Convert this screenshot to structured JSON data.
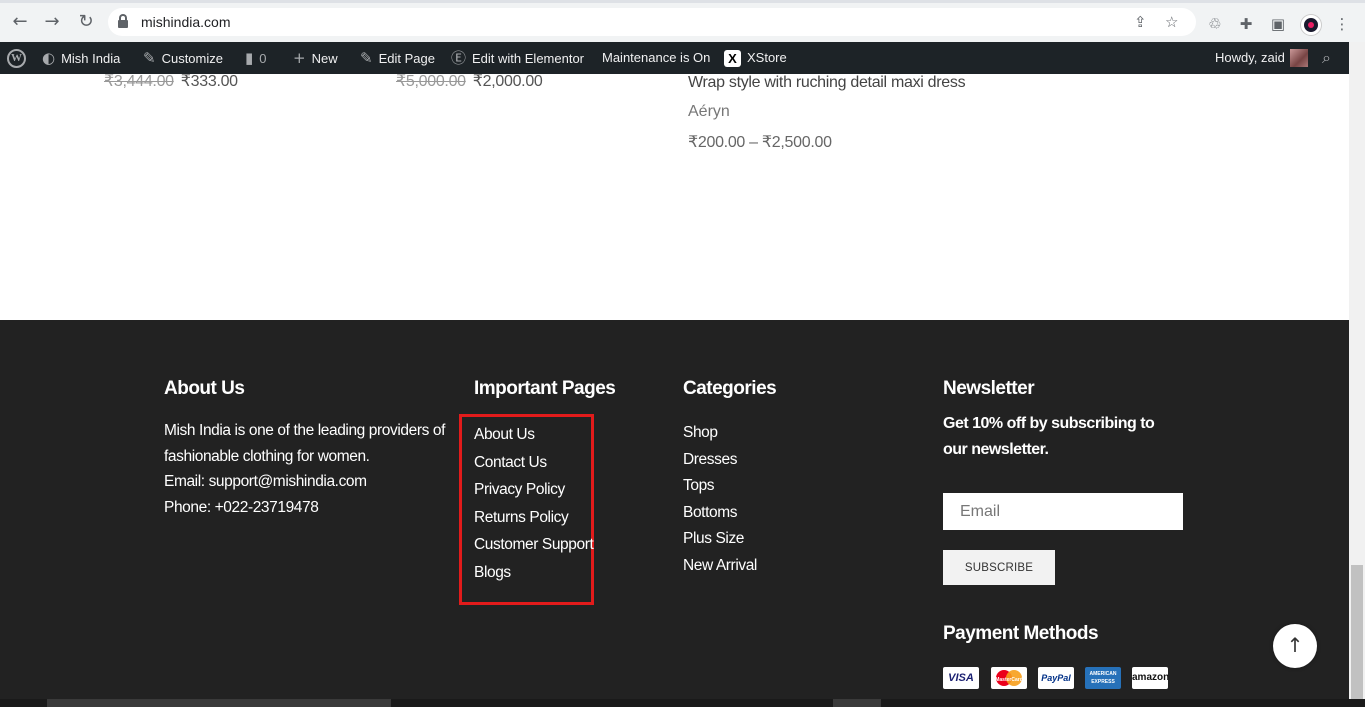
{
  "browser": {
    "url": "mishindia.com"
  },
  "admin_bar": {
    "site_name": "Mish India",
    "customize": "Customize",
    "comments_count": "0",
    "new": "New",
    "edit_page": "Edit Page",
    "elementor": "Edit with Elementor",
    "maintenance": "Maintenance is On",
    "xstore": "XStore",
    "howdy": "Howdy, zaid"
  },
  "products": [
    {
      "old_price": "₹3,444.00",
      "price": "₹333.00"
    },
    {
      "old_price": "₹5,000.00",
      "price": "₹2,000.00"
    },
    {
      "title": "Wrap style with ruching detail maxi dress",
      "brand": "Aéryn",
      "price_range": "₹200.00 – ₹2,500.00"
    }
  ],
  "footer": {
    "about": {
      "title": "About Us",
      "line1": "Mish India is one of the leading providers of",
      "line2": "fashionable clothing for women.",
      "email": "Email: support@mishindia.com",
      "phone": "Phone: +022-23719478"
    },
    "important_pages": {
      "title": "Important Pages",
      "links": [
        "About Us",
        "Contact Us",
        "Privacy Policy",
        "Returns Policy",
        "Customer Support",
        "Blogs"
      ]
    },
    "categories": {
      "title": "Categories",
      "links": [
        "Shop",
        "Dresses",
        "Tops",
        "Bottoms",
        "Plus Size",
        "New Arrival"
      ]
    },
    "newsletter": {
      "title": "Newsletter",
      "description": "Get 10% off by subscribing to our newsletter.",
      "email_placeholder": "Email",
      "subscribe_label": "SUBSCRIBE"
    },
    "payment": {
      "title": "Payment Methods",
      "cards": [
        "VISA",
        "MasterCard",
        "PayPal",
        "AMERICAN EXPRESS",
        "amazon"
      ]
    }
  },
  "colors": {
    "footer_bg": "#222222",
    "highlight": "#e21b1b",
    "admin_bar_bg": "#1d2327"
  }
}
